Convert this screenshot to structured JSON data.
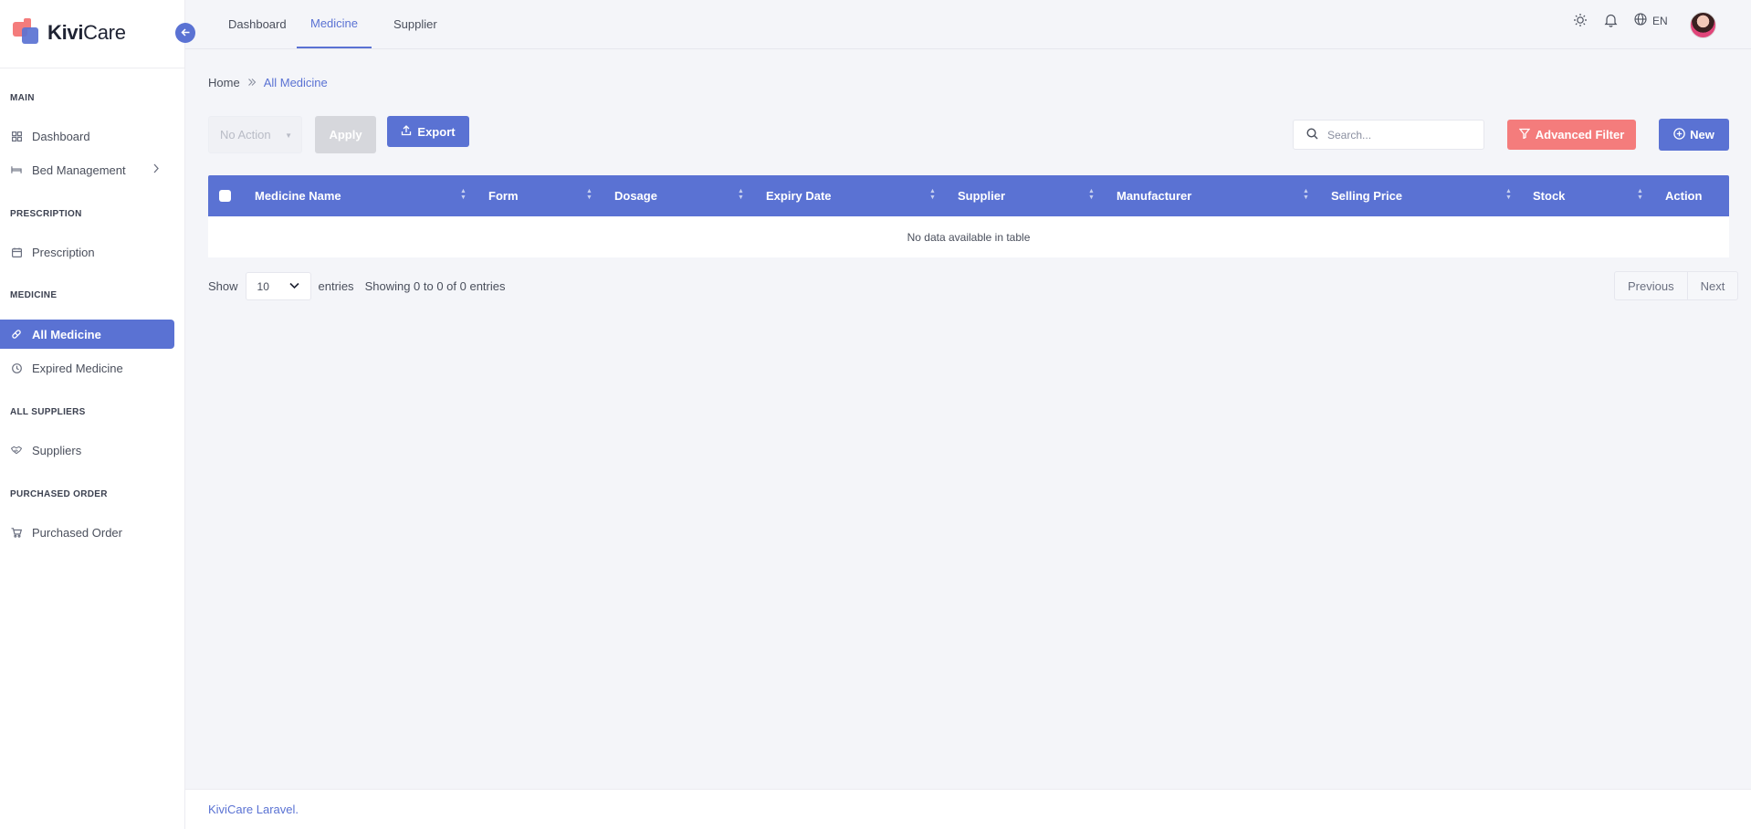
{
  "brand": {
    "name_bold": "Kivi",
    "name_rest": "Care"
  },
  "sidebar": {
    "sections": [
      {
        "title": "MAIN"
      },
      {
        "title": "PRESCRIPTION"
      },
      {
        "title": "MEDICINE"
      },
      {
        "title": "ALL SUPPLIERS"
      },
      {
        "title": "PURCHASED ORDER"
      }
    ],
    "items": [
      {
        "label": "Dashboard",
        "icon": "grid-icon"
      },
      {
        "label": "Bed Management",
        "icon": "bed-icon"
      },
      {
        "label": "Prescription",
        "icon": "calendar-icon"
      },
      {
        "label": "All Medicine",
        "icon": "pill-icon",
        "active": true
      },
      {
        "label": "Expired Medicine",
        "icon": "clock-icon"
      },
      {
        "label": "Suppliers",
        "icon": "handshake-icon"
      },
      {
        "label": "Purchased Order",
        "icon": "cart-icon"
      }
    ]
  },
  "topbar": {
    "tabs": [
      {
        "label": "Dashboard"
      },
      {
        "label": "Medicine",
        "active": true
      },
      {
        "label": "Supplier"
      }
    ],
    "language": "EN"
  },
  "breadcrumb": {
    "home": "Home",
    "current": "All Medicine"
  },
  "toolbar": {
    "bulk_action": "No Action",
    "apply_label": "Apply",
    "export_label": "Export",
    "search_placeholder": "Search...",
    "filter_label": "Advanced Filter",
    "new_label": "New"
  },
  "table": {
    "columns": [
      "Medicine Name",
      "Form",
      "Dosage",
      "Expiry Date",
      "Supplier",
      "Manufacturer",
      "Selling Price",
      "Stock",
      "Action"
    ],
    "empty_message": "No data available in table"
  },
  "pagination": {
    "show_label": "Show",
    "page_size": "10",
    "entries_label": "entries",
    "info": "Showing 0 to 0 of 0 entries",
    "prev_label": "Previous",
    "next_label": "Next"
  },
  "footer": {
    "text": "KiviCare Laravel."
  },
  "colors": {
    "primary": "#5a72d3",
    "danger": "#f47c7c"
  }
}
